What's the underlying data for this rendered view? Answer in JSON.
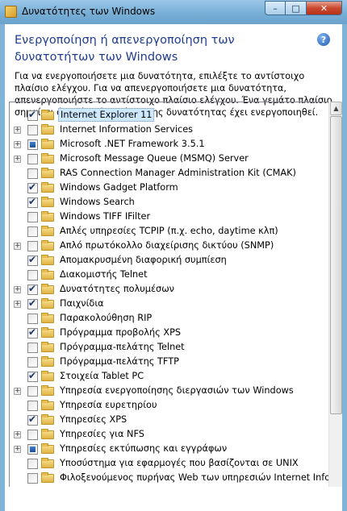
{
  "window": {
    "title": "Δυνατότητες των Windows"
  },
  "header": {
    "title": "Ενεργοποίηση ή απενεργοποίηση των δυνατοτήτων των Windows"
  },
  "description": "Για να ενεργοποιήσετε μια δυνατότητα, επιλέξτε το αντίστοιχο πλαίσιο ελέγχου. Για να απενεργοποιήσετε μια δυνατότητα, απενεργοποιήστε το αντίστοιχο πλαίσιο ελέγχου. Ένα γεμάτο πλαίσιο σημαίνει ότι μόνο ένα μέρος της δυνατότητας έχει ενεργοποιηθεί.",
  "icons": {
    "app": "windows-features-icon",
    "help": "help-icon",
    "folder": "folder-icon"
  },
  "features": [
    {
      "label": "Internet Explorer 11",
      "state": "checked",
      "expandable": false,
      "selected": true
    },
    {
      "label": "Internet Information Services",
      "state": "unchecked",
      "expandable": true
    },
    {
      "label": "Microsoft .NET Framework 3.5.1",
      "state": "partial",
      "expandable": true
    },
    {
      "label": "Microsoft Message Queue (MSMQ) Server",
      "state": "unchecked",
      "expandable": true
    },
    {
      "label": "RAS Connection Manager Administration Kit (CMAK)",
      "state": "unchecked",
      "expandable": false
    },
    {
      "label": "Windows Gadget Platform",
      "state": "checked",
      "expandable": false
    },
    {
      "label": "Windows Search",
      "state": "checked",
      "expandable": false
    },
    {
      "label": "Windows TIFF IFilter",
      "state": "unchecked",
      "expandable": false
    },
    {
      "label": "Απλές υπηρεσίες TCPIP (π.χ. echo, daytime κλπ)",
      "state": "unchecked",
      "expandable": false
    },
    {
      "label": "Απλό πρωτόκολλο διαχείρισης δικτύου (SNMP)",
      "state": "unchecked",
      "expandable": true
    },
    {
      "label": "Απομακρυσμένη διαφορική συμπίεση",
      "state": "checked",
      "expandable": false
    },
    {
      "label": "Διακομιστής Telnet",
      "state": "unchecked",
      "expandable": false
    },
    {
      "label": "Δυνατότητες πολυμέσων",
      "state": "checked",
      "expandable": true
    },
    {
      "label": "Παιχνίδια",
      "state": "checked",
      "expandable": true
    },
    {
      "label": "Παρακολούθηση RIP",
      "state": "unchecked",
      "expandable": false
    },
    {
      "label": "Πρόγραμμα προβολής XPS",
      "state": "checked",
      "expandable": false
    },
    {
      "label": "Πρόγραμμα-πελάτης Telnet",
      "state": "unchecked",
      "expandable": false
    },
    {
      "label": "Πρόγραμμα-πελάτης TFTP",
      "state": "unchecked",
      "expandable": false
    },
    {
      "label": "Στοιχεία Tablet PC",
      "state": "checked",
      "expandable": false
    },
    {
      "label": "Υπηρεσία ενεργοποίησης διεργασιών των Windows",
      "state": "unchecked",
      "expandable": true
    },
    {
      "label": "Υπηρεσία ευρετηρίου",
      "state": "unchecked",
      "expandable": false
    },
    {
      "label": "Υπηρεσίες XPS",
      "state": "checked",
      "expandable": false
    },
    {
      "label": "Υπηρεσίες για NFS",
      "state": "unchecked",
      "expandable": true
    },
    {
      "label": "Υπηρεσίες εκτύπωσης και εγγράφων",
      "state": "partial",
      "expandable": true
    },
    {
      "label": "Υποσύστημα για εφαρμογές που βασίζονται σε UNIX",
      "state": "unchecked",
      "expandable": false
    },
    {
      "label": "Φιλοξενούμενος πυρήνας Web των υπηρεσιών Internet Information Services",
      "state": "unchecked",
      "expandable": false
    }
  ]
}
